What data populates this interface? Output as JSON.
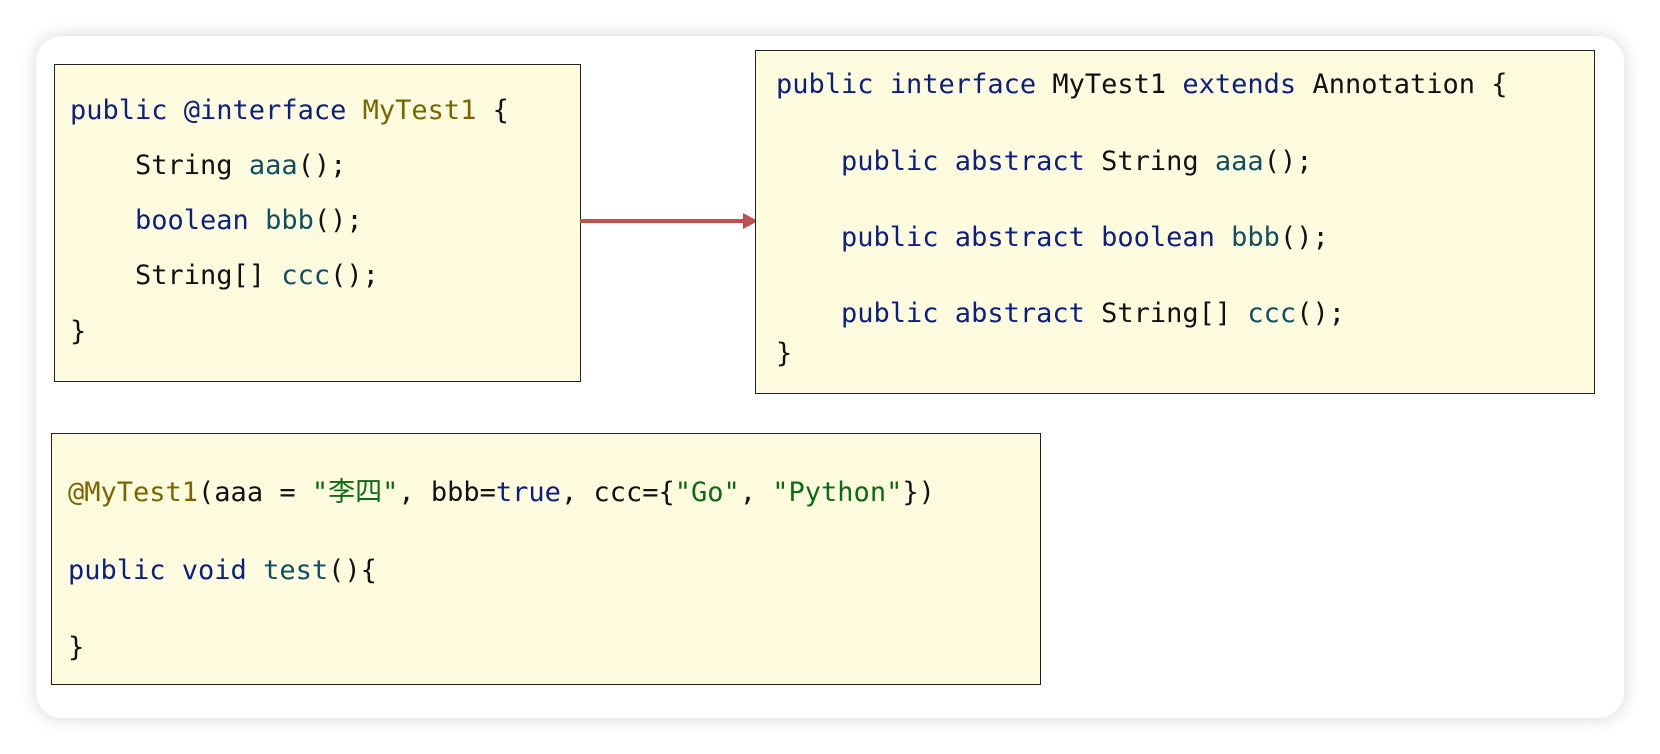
{
  "box_left": {
    "lines": [
      [
        {
          "t": "public @interface ",
          "c": "kw"
        },
        {
          "t": "MyTest1",
          "c": "nm"
        },
        {
          "t": " {",
          "c": "pl"
        }
      ],
      [
        {
          "t": "    String ",
          "c": "ty"
        },
        {
          "t": "aaa",
          "c": "fn"
        },
        {
          "t": "();",
          "c": "pl"
        }
      ],
      [
        {
          "t": "    boolean ",
          "c": "kw"
        },
        {
          "t": "bbb",
          "c": "fn"
        },
        {
          "t": "();",
          "c": "pl"
        }
      ],
      [
        {
          "t": "    String[] ",
          "c": "ty"
        },
        {
          "t": "ccc",
          "c": "fn"
        },
        {
          "t": "();",
          "c": "pl"
        }
      ],
      [
        {
          "t": "}",
          "c": "pl"
        }
      ]
    ]
  },
  "box_right": {
    "lines": [
      [
        {
          "t": "public interface ",
          "c": "kw"
        },
        {
          "t": "MyTest1 ",
          "c": "ty"
        },
        {
          "t": "extends ",
          "c": "kw"
        },
        {
          "t": "Annotation {",
          "c": "ty"
        }
      ],
      [
        {
          "t": "    public abstract ",
          "c": "kw"
        },
        {
          "t": "String ",
          "c": "ty"
        },
        {
          "t": "aaa",
          "c": "fn"
        },
        {
          "t": "();",
          "c": "pl"
        }
      ],
      [
        {
          "t": "    public abstract boolean ",
          "c": "kw"
        },
        {
          "t": "bbb",
          "c": "fn"
        },
        {
          "t": "();",
          "c": "pl"
        }
      ],
      [
        {
          "t": "    public abstract ",
          "c": "kw"
        },
        {
          "t": "String[] ",
          "c": "ty"
        },
        {
          "t": "ccc",
          "c": "fn"
        },
        {
          "t": "();",
          "c": "pl"
        }
      ],
      [
        {
          "t": "}",
          "c": "pl"
        }
      ]
    ]
  },
  "box_bottom": {
    "lines": [
      [
        {
          "t": "@MyTest1",
          "c": "nm"
        },
        {
          "t": "(aaa = ",
          "c": "pl"
        },
        {
          "t": "\"李四\"",
          "c": "st"
        },
        {
          "t": ", bbb=",
          "c": "pl"
        },
        {
          "t": "true",
          "c": "kw"
        },
        {
          "t": ", ccc={",
          "c": "pl"
        },
        {
          "t": "\"Go\"",
          "c": "st"
        },
        {
          "t": ", ",
          "c": "pl"
        },
        {
          "t": "\"Python\"",
          "c": "st"
        },
        {
          "t": "})",
          "c": "pl"
        }
      ],
      [
        {
          "t": "public void ",
          "c": "kw"
        },
        {
          "t": "test",
          "c": "fn"
        },
        {
          "t": "(){",
          "c": "pl"
        }
      ],
      [
        {
          "t": "}",
          "c": "pl"
        }
      ]
    ]
  },
  "colors": {
    "panel_background": "#fefbdf",
    "keyword": "#0b1f80",
    "annotation_name": "#7a6400",
    "method_name": "#0f4f62",
    "string_literal": "#0b6b12",
    "arrow": "#c0504d"
  }
}
